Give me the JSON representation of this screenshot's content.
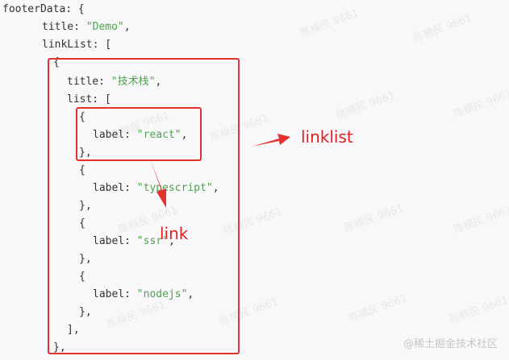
{
  "code_lines": [
    {
      "parts": [
        {
          "t": "footerData: {",
          "c": "key"
        }
      ]
    },
    {
      "parts": [
        {
          "t": "title: ",
          "c": "key"
        },
        {
          "t": "\"Demo\"",
          "c": "str"
        },
        {
          "t": ",",
          "c": "key"
        }
      ]
    },
    {
      "parts": [
        {
          "t": "linkList: [",
          "c": "key"
        }
      ]
    },
    {
      "parts": [
        {
          "t": "{",
          "c": "key"
        }
      ]
    },
    {
      "parts": [
        {
          "t": "title: ",
          "c": "key"
        },
        {
          "t": "\"技术栈\"",
          "c": "str"
        },
        {
          "t": ",",
          "c": "key"
        }
      ]
    },
    {
      "parts": [
        {
          "t": "list: [",
          "c": "key"
        }
      ]
    },
    {
      "parts": [
        {
          "t": "{",
          "c": "key"
        }
      ]
    },
    {
      "parts": [
        {
          "t": "label: ",
          "c": "key"
        },
        {
          "t": "\"react\"",
          "c": "str"
        },
        {
          "t": ",",
          "c": "key"
        }
      ]
    },
    {
      "parts": [
        {
          "t": "},",
          "c": "key"
        }
      ]
    },
    {
      "parts": [
        {
          "t": "{",
          "c": "key"
        }
      ]
    },
    {
      "parts": [
        {
          "t": "label: ",
          "c": "key"
        },
        {
          "t": "\"typescript\"",
          "c": "str"
        },
        {
          "t": ",",
          "c": "key"
        }
      ]
    },
    {
      "parts": [
        {
          "t": "},",
          "c": "key"
        }
      ]
    },
    {
      "parts": [
        {
          "t": "{",
          "c": "key"
        }
      ]
    },
    {
      "parts": [
        {
          "t": "label: ",
          "c": "key"
        },
        {
          "t": "\"ssr\"",
          "c": "str"
        },
        {
          "t": ",",
          "c": "key"
        }
      ]
    },
    {
      "parts": [
        {
          "t": "},",
          "c": "key"
        }
      ]
    },
    {
      "parts": [
        {
          "t": "{",
          "c": "key"
        }
      ]
    },
    {
      "parts": [
        {
          "t": "label: ",
          "c": "key"
        },
        {
          "t": "\"nodejs\"",
          "c": "str"
        },
        {
          "t": ",",
          "c": "key"
        }
      ]
    },
    {
      "parts": [
        {
          "t": "},",
          "c": "key"
        }
      ]
    },
    {
      "parts": [
        {
          "t": "],",
          "c": "key"
        }
      ]
    },
    {
      "parts": [
        {
          "t": "},",
          "c": "key"
        }
      ]
    }
  ],
  "annotations": {
    "linklist_label": "linklist",
    "link_label": "link",
    "accent_color": "#e5312f"
  },
  "watermark_text": "陈楠民 9661",
  "brand_text": "@稀土掘金技术社区"
}
